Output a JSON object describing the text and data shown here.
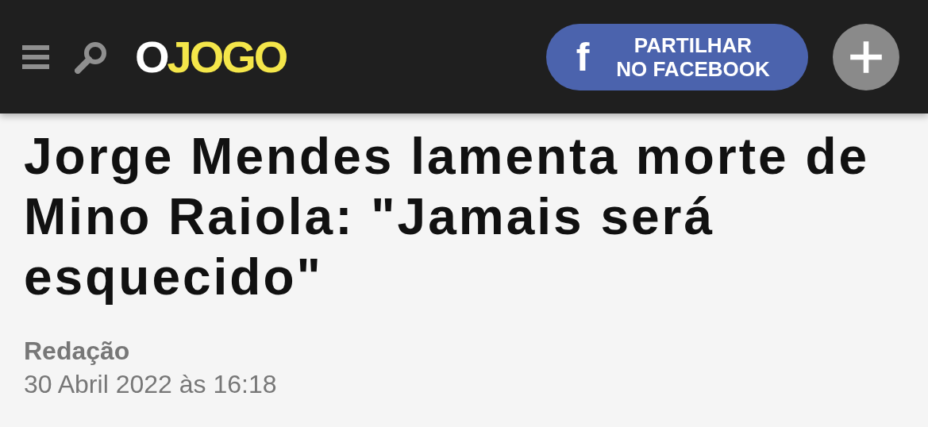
{
  "header": {
    "logo": {
      "first": "O",
      "rest": "JOGO"
    },
    "share_button": {
      "lines": [
        "PARTILHAR",
        "NO FACEBOOK"
      ],
      "icon": "f"
    }
  },
  "article": {
    "headline": "Jorge Mendes lamenta morte de Mino Raiola: \"Jamais será esquecido\"",
    "author": "Redação",
    "date": "30 Abril 2022 às 16:18"
  }
}
